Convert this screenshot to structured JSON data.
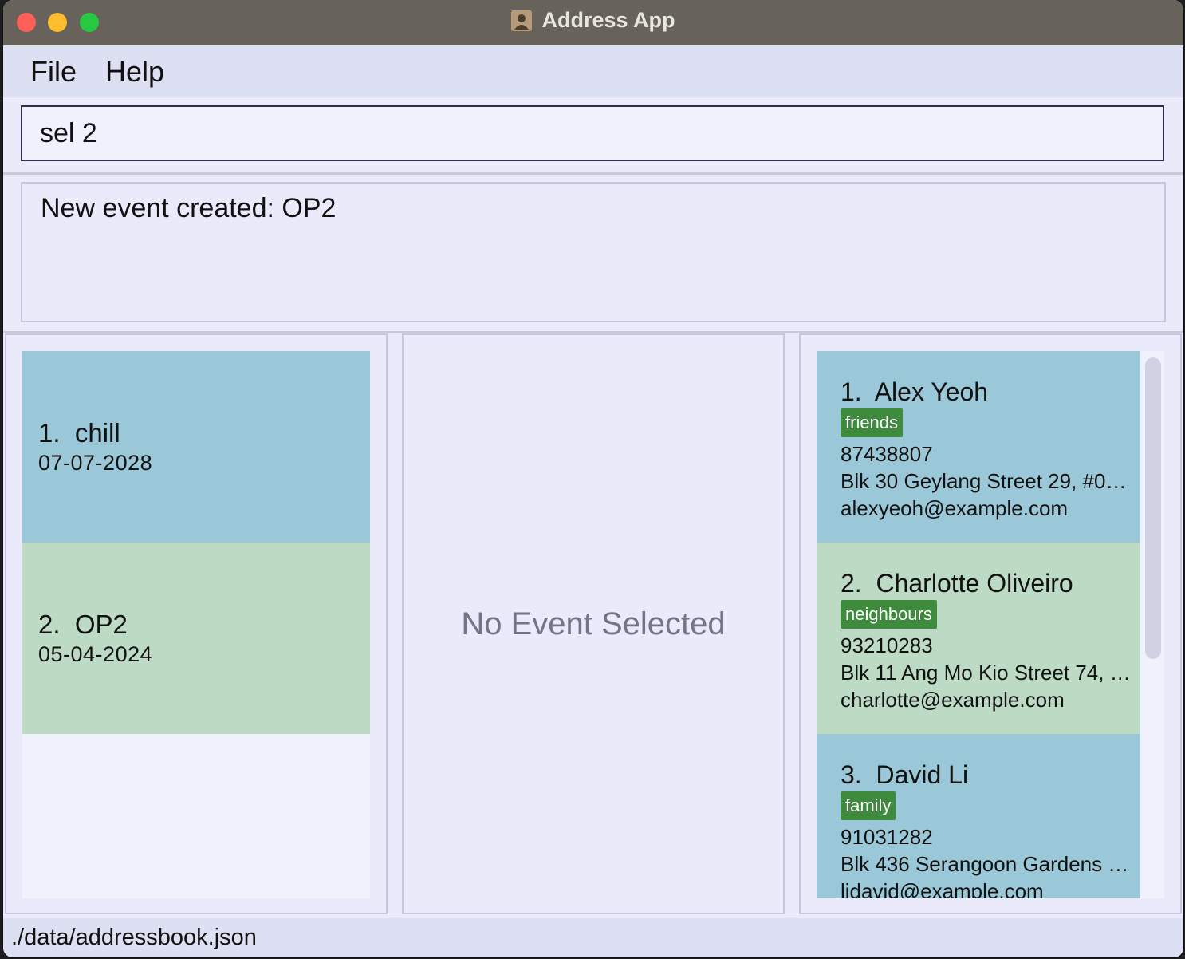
{
  "window": {
    "title": "Address App"
  },
  "menu": {
    "file": "File",
    "help": "Help"
  },
  "command": {
    "value": "sel 2"
  },
  "result": {
    "text": "New event created: OP2"
  },
  "events": [
    {
      "index": "1.",
      "name": "chill",
      "date": "07-07-2028",
      "color": "#9bc8d8"
    },
    {
      "index": "2.",
      "name": "OP2",
      "date": "05-04-2024",
      "color": "#bcdac4"
    }
  ],
  "detail": {
    "placeholder": "No Event Selected"
  },
  "persons": [
    {
      "index": "1.",
      "name": "Alex Yeoh",
      "tag": "friends",
      "phone": "87438807",
      "address": "Blk 30 Geylang Street 29, #06-...",
      "email": "alexyeoh@example.com"
    },
    {
      "index": "2.",
      "name": "Charlotte Oliveiro",
      "tag": "neighbours",
      "phone": "93210283",
      "address": "Blk 11 Ang Mo Kio Street 74, #1...",
      "email": "charlotte@example.com"
    },
    {
      "index": "3.",
      "name": "David Li",
      "tag": "family",
      "phone": "91031282",
      "address": "Blk 436 Serangoon Gardens St...",
      "email": "lidavid@example.com"
    }
  ],
  "status": {
    "path": "./data/addressbook.json"
  },
  "colors": {
    "card_blue": "#9bc8d8",
    "card_green": "#bcdac4",
    "tag_green": "#3e8b3e",
    "titlebar": "#67625a"
  },
  "icons": {
    "app": "address-book-icon"
  }
}
